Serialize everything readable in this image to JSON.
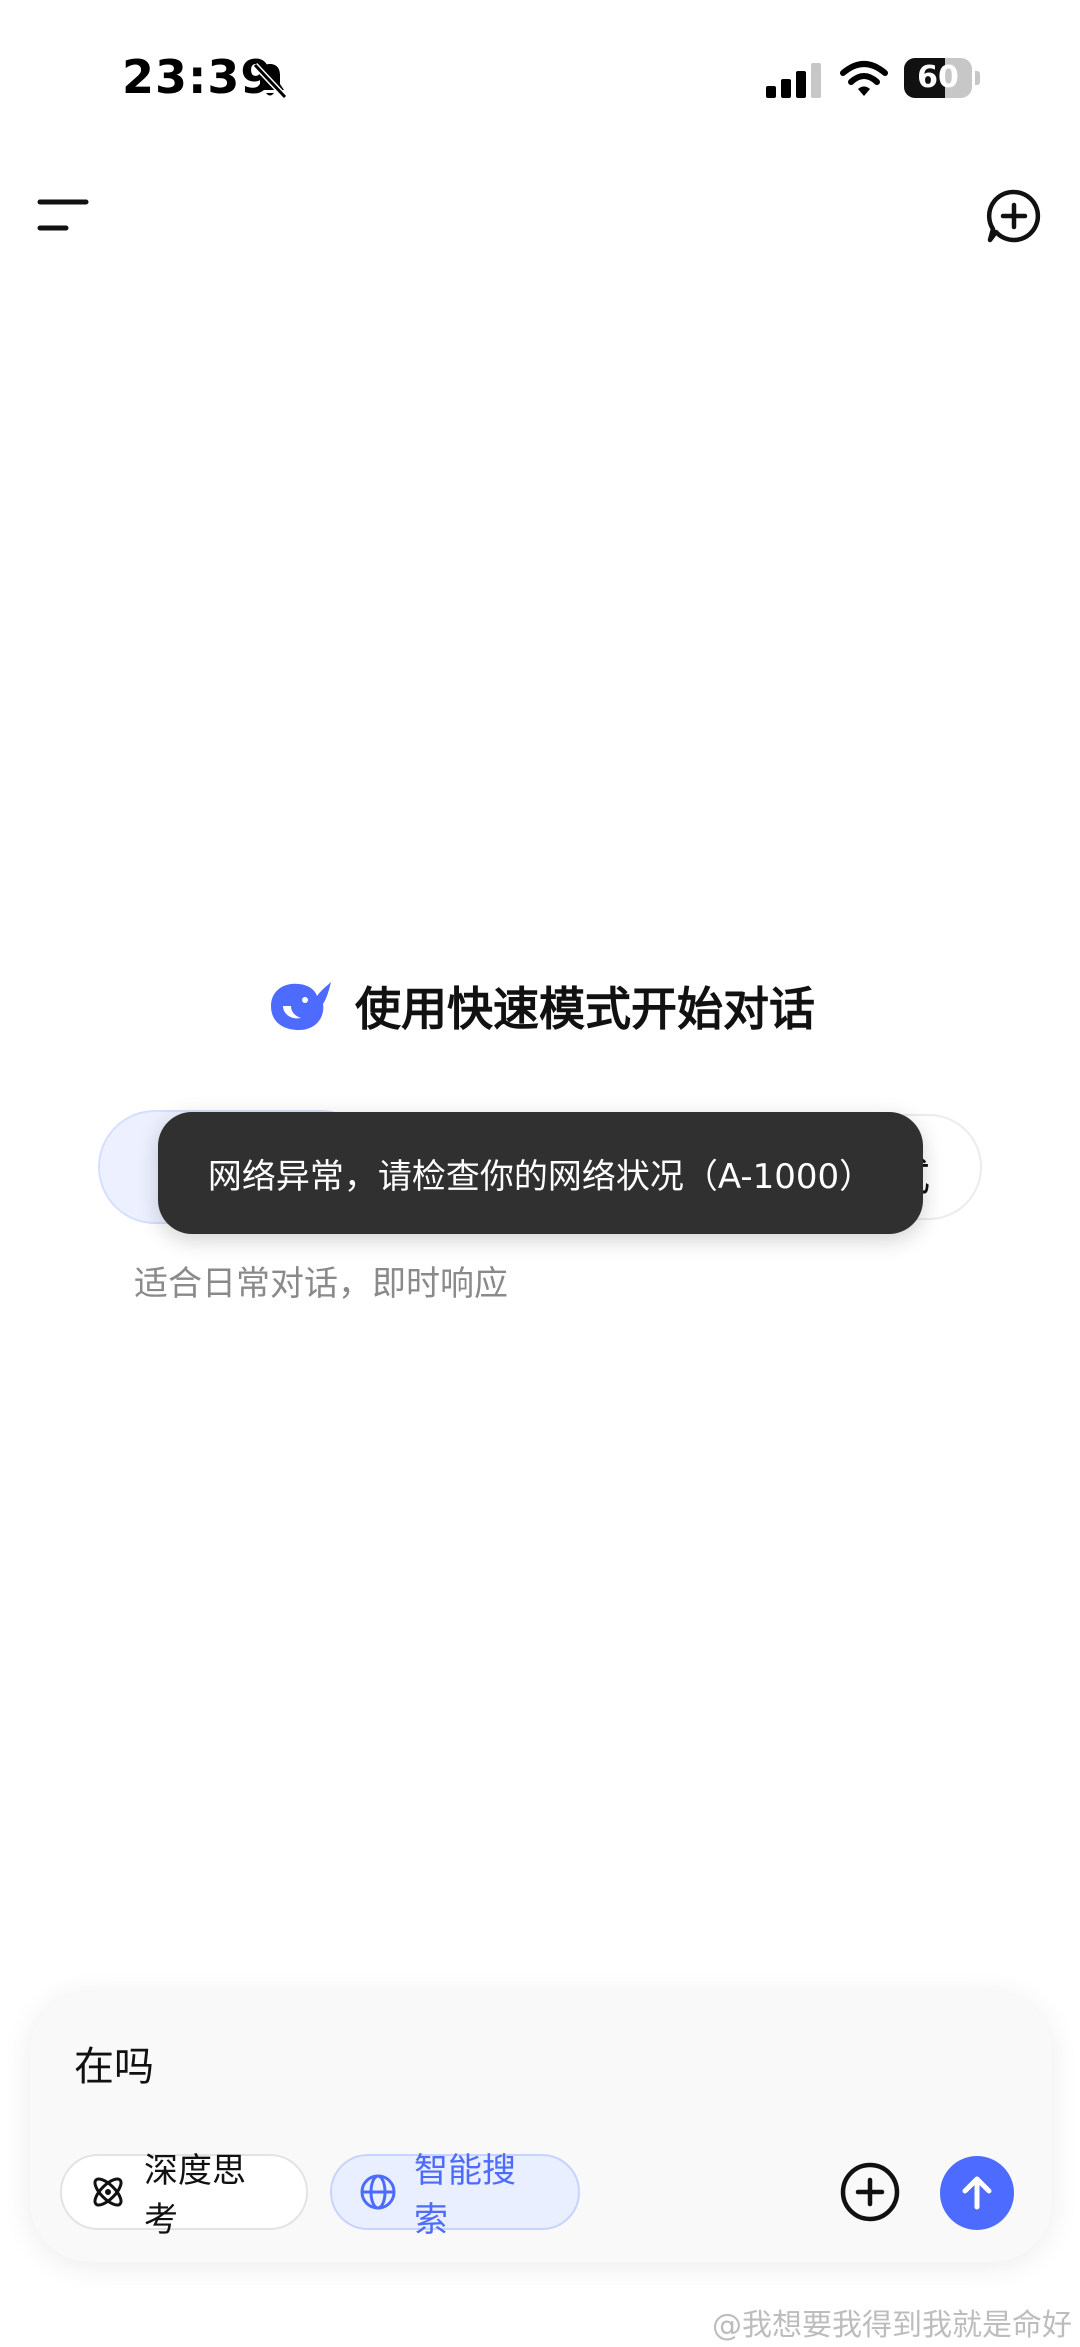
{
  "status_bar": {
    "time": "23:39",
    "battery_level": "60",
    "battery_fraction": 0.6,
    "icons": [
      "bell-off-icon",
      "signal-icon",
      "wifi-icon",
      "battery-icon"
    ]
  },
  "header": {
    "icons": [
      "menu-icon",
      "new-chat-icon"
    ]
  },
  "welcome": {
    "title": "使用快速模式开始对话",
    "logo_icon": "whale-logo",
    "logo_color": "#4d6bfe"
  },
  "mode": {
    "right_label_fragment": "式",
    "description": "适合日常对话，即时响应"
  },
  "toast": {
    "message": "网络异常，请检查你的网络状况（A-1000）"
  },
  "composer": {
    "input_value": "在吗",
    "chips": [
      {
        "label": "深度思考",
        "icon": "atom-icon",
        "active": false
      },
      {
        "label": "智能搜索",
        "icon": "globe-icon",
        "active": true
      }
    ],
    "attach_icon": "plus-circle-icon",
    "send_icon": "arrow-up-icon",
    "accent_color": "#4d6bfe"
  },
  "watermark": {
    "text": "@我想要我得到我就是命好"
  }
}
